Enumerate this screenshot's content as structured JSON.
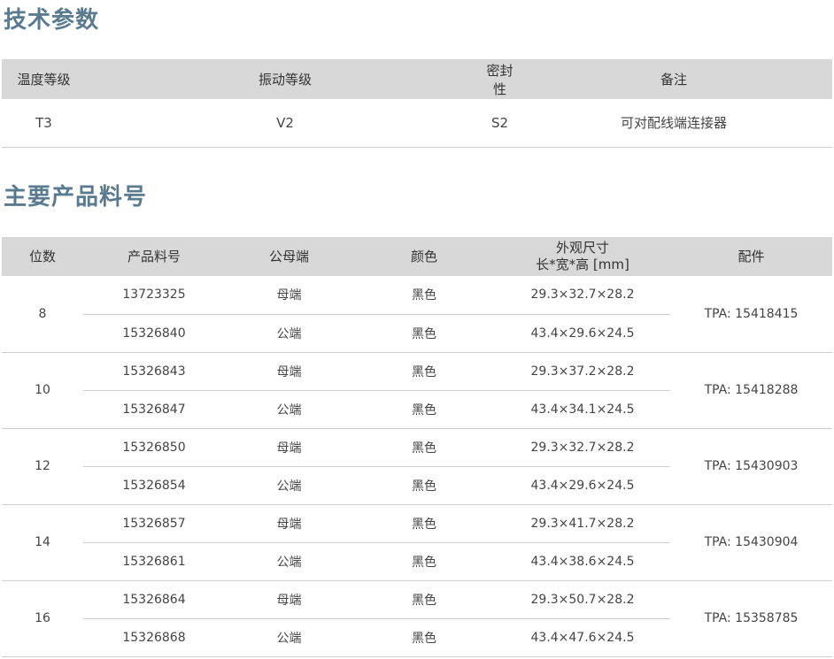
{
  "spec_section": {
    "title": "技术参数",
    "headers": [
      "温度等级",
      "振动等级",
      "密封性",
      "备注"
    ],
    "row": [
      "T3",
      "V2",
      "S2",
      "可对配线端连接器"
    ]
  },
  "parts_section": {
    "title": "主要产品料号",
    "headers": {
      "count": "位数",
      "part_no": "产品料号",
      "gender": "公母端",
      "color": "颜色",
      "dims_line1": "外观尺寸",
      "dims_line2": "长*宽*高 [mm]",
      "accessory": "配件"
    },
    "groups": [
      {
        "count": "8",
        "accessory": "TPA: 15418415",
        "rows": [
          {
            "part_no": "13723325",
            "gender": "母端",
            "color": "黑色",
            "dims": "29.3×32.7×28.2"
          },
          {
            "part_no": "15326840",
            "gender": "公端",
            "color": "黑色",
            "dims": "43.4×29.6×24.5"
          }
        ]
      },
      {
        "count": "10",
        "accessory": "TPA: 15418288",
        "rows": [
          {
            "part_no": "15326843",
            "gender": "母端",
            "color": "黑色",
            "dims": "29.3×37.2×28.2"
          },
          {
            "part_no": "15326847",
            "gender": "公端",
            "color": "黑色",
            "dims": "43.4×34.1×24.5"
          }
        ]
      },
      {
        "count": "12",
        "accessory": "TPA: 15430903",
        "rows": [
          {
            "part_no": "15326850",
            "gender": "母端",
            "color": "黑色",
            "dims": "29.3×32.7×28.2"
          },
          {
            "part_no": "15326854",
            "gender": "公端",
            "color": "黑色",
            "dims": "43.4×29.6×24.5"
          }
        ]
      },
      {
        "count": "14",
        "accessory": "TPA: 15430904",
        "rows": [
          {
            "part_no": "15326857",
            "gender": "母端",
            "color": "黑色",
            "dims": "29.3×41.7×28.2"
          },
          {
            "part_no": "15326861",
            "gender": "公端",
            "color": "黑色",
            "dims": "43.4×38.6×24.5"
          }
        ]
      },
      {
        "count": "16",
        "accessory": "TPA: 15358785",
        "rows": [
          {
            "part_no": "15326864",
            "gender": "母端",
            "color": "黑色",
            "dims": "29.3×50.7×28.2"
          },
          {
            "part_no": "15326868",
            "gender": "公端",
            "color": "黑色",
            "dims": "43.4×47.6×24.5"
          }
        ]
      }
    ]
  },
  "colors": {
    "title": "#5a7b8f",
    "header_bg": "#d8d8d8",
    "divider": "#cfcfcf"
  }
}
